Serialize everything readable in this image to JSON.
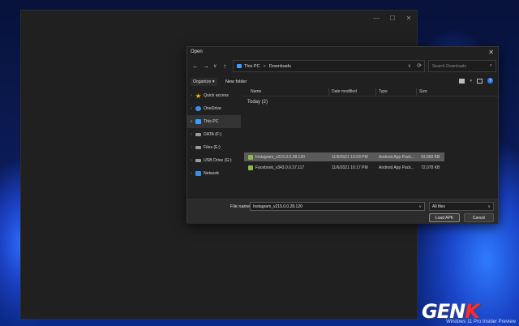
{
  "desktop": {
    "watermark": "Windows 11 Pro Insider Preview",
    "logo_prefix": "GEN",
    "logo_suffix": "K"
  },
  "host_window": {
    "controls": [
      "—",
      "☐",
      "✕"
    ]
  },
  "dialog": {
    "title": "Open",
    "close_glyph": "✕",
    "nav": {
      "back": "←",
      "forward": "→",
      "recent": "∨",
      "up": "↑"
    },
    "address": {
      "segments": [
        "This PC",
        "Downloads"
      ],
      "separator": ">",
      "dropdown": "∨",
      "refresh": "⟳"
    },
    "search": {
      "placeholder": "Search Downloads",
      "icon": "search-icon"
    },
    "toolbar": {
      "organize": "Organize ▾",
      "new_folder": "New folder"
    },
    "sidebar": {
      "items": [
        {
          "label": "Quick access",
          "icon": "star-icon",
          "color": "#f2c200"
        },
        {
          "label": "OneDrive",
          "icon": "cloud-icon",
          "color": "#3a8fe8"
        },
        {
          "label": "This PC",
          "icon": "pc-icon",
          "color": "#3aa0ff",
          "selected": true
        },
        {
          "label": "DATA (F:)",
          "icon": "drive-icon",
          "color": "#9a9a9a"
        },
        {
          "label": "Files (E:)",
          "icon": "drive-icon",
          "color": "#9a9a9a"
        },
        {
          "label": "USB Drive (G:)",
          "icon": "usb-drive-icon",
          "color": "#9a9a9a"
        },
        {
          "label": "Network",
          "icon": "network-icon",
          "color": "#3a8fe8"
        }
      ]
    },
    "columns": [
      "Name",
      "Date modified",
      "Type",
      "Size"
    ],
    "group": "Today (2)",
    "files": [
      {
        "name": "Instagram_v215.0.0.28.120",
        "date": "11/6/2021 10:03 PM",
        "type": "Android App Pack...",
        "size": "43,960 KB",
        "selected": true
      },
      {
        "name": "Facebook_v343.0.0.37.117",
        "date": "11/6/2021 10:17 PM",
        "type": "Android App Pack...",
        "size": "72,078 KB",
        "selected": false
      }
    ],
    "footer": {
      "file_name_label": "File name:",
      "file_name_value": "Instagram_v215.0.0.28.120",
      "filter": "All files",
      "dropdown": "∨",
      "load_label": "Load APK",
      "cancel_label": "Cancel"
    }
  }
}
